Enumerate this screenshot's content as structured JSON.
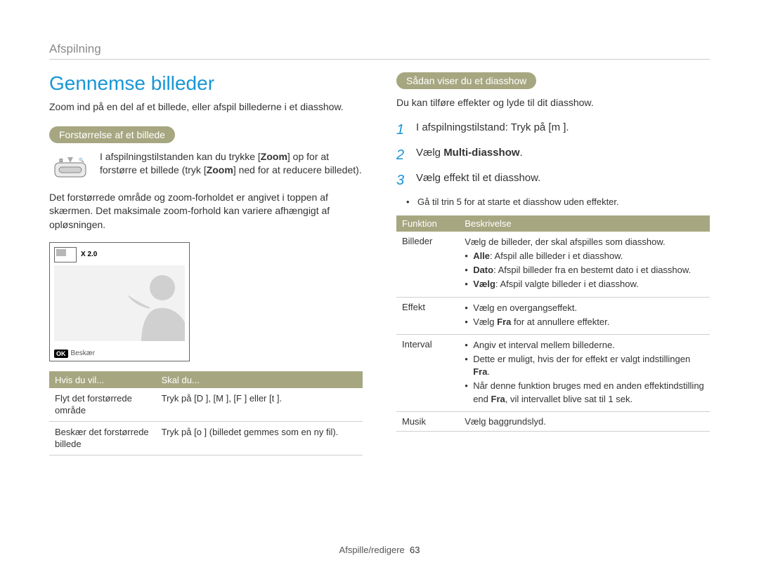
{
  "breadcrumb": "Afspilning",
  "title": "Gennemse billeder",
  "left": {
    "intro": "Zoom ind på en del af et billede, eller afspil billederne i et diasshow.",
    "pill": "Forstørrelse af et billede",
    "zoom_text_pre": "I afspilningstilstanden kan du trykke [",
    "zoom_word1": "Zoom",
    "zoom_text_mid": "] op for at forstørre et billede (tryk [",
    "zoom_word2": "Zoom",
    "zoom_text_end": "] ned for at reducere billedet).",
    "para2": "Det forstørrede område og zoom-forholdet er angivet i toppen af skærmen. Det maksimale zoom-forhold kan variere afhængigt af opløsningen.",
    "preview_zoom": "X 2.0",
    "preview_footer_badge": "OK",
    "preview_footer_label": "Beskær",
    "tbl_h1": "Hvis du vil...",
    "tbl_h2": "Skal du...",
    "tbl_r1_c1": "Flyt det forstørrede område",
    "tbl_r1_c2": "Tryk på [D     ], [M  ], [F   ] eller [t      ].",
    "tbl_r2_c1": "Beskær det forstørrede billede",
    "tbl_r2_c2": "Tryk på [o     ] (billedet gemmes som en ny fil)."
  },
  "right": {
    "pill": "Sådan viser du et diasshow",
    "intro": "Du kan tilføre effekter og lyde til dit diasshow.",
    "step1": "I afspilningstilstand: Tryk på [m       ].",
    "step2_pre": "Vælg ",
    "step2_bold": "Multi-diasshow",
    "step2_post": ".",
    "step3": "Vælg effekt til et diasshow.",
    "bullet": "Gå til trin 5 for at starte et diasshow uden effekter.",
    "func_h1": "Funktion",
    "func_h2": "Beskrivelse",
    "rows": {
      "billeder": {
        "label": "Billeder",
        "line1": "Vælg de billeder, der skal afspilles som diasshow.",
        "b1_b": "Alle",
        "b1_rest": ": Afspil alle billeder i et diasshow.",
        "b2_b": "Dato",
        "b2_rest": ": Afspil billeder fra en bestemt dato i et diasshow.",
        "b3_b": "Vælg",
        "b3_rest": ": Afspil valgte billeder i et diasshow."
      },
      "effekt": {
        "label": "Effekt",
        "b1": "Vælg en overgangseffekt.",
        "b2_pre": "Vælg ",
        "b2_b": "Fra",
        "b2_post": " for at annullere effekter."
      },
      "interval": {
        "label": "Interval",
        "b1": "Angiv et interval mellem billederne.",
        "b2_pre": "Dette er muligt, hvis der for effekt er valgt indstillingen ",
        "b2_b": "Fra",
        "b2_post": ".",
        "b3_pre": "Når denne funktion bruges med en anden effektindstilling end ",
        "b3_b": "Fra",
        "b3_post": ", vil intervallet blive sat til 1 sek."
      },
      "musik": {
        "label": "Musik",
        "desc": "Vælg baggrundslyd."
      }
    }
  },
  "footer_label": "Afspille/redigere",
  "footer_page": "63"
}
